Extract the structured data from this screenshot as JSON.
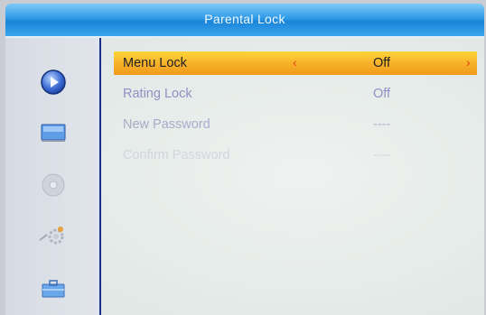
{
  "window": {
    "title": "Parental Lock"
  },
  "sidebar": {
    "icons": [
      {
        "name": "play-icon",
        "active": true
      },
      {
        "name": "picture-icon",
        "active": false
      },
      {
        "name": "disc-icon",
        "active": false
      },
      {
        "name": "settings-gear-icon",
        "active": false
      },
      {
        "name": "toolbox-icon",
        "active": false
      }
    ]
  },
  "menu": {
    "rows": [
      {
        "label": "Menu Lock",
        "value": "Off",
        "selected": true
      },
      {
        "label": "Rating Lock",
        "value": "Off",
        "selected": false
      },
      {
        "label": "New Password",
        "value": "----",
        "selected": false
      },
      {
        "label": "Confirm Password",
        "value": "----",
        "selected": false
      }
    ],
    "left_arrow": "‹",
    "right_arrow": "›"
  },
  "colors": {
    "title_bar": "#2f9be8",
    "selection": "#f7b22a",
    "arrow": "#e8401c",
    "sidebar_border": "#1c2f8c"
  }
}
